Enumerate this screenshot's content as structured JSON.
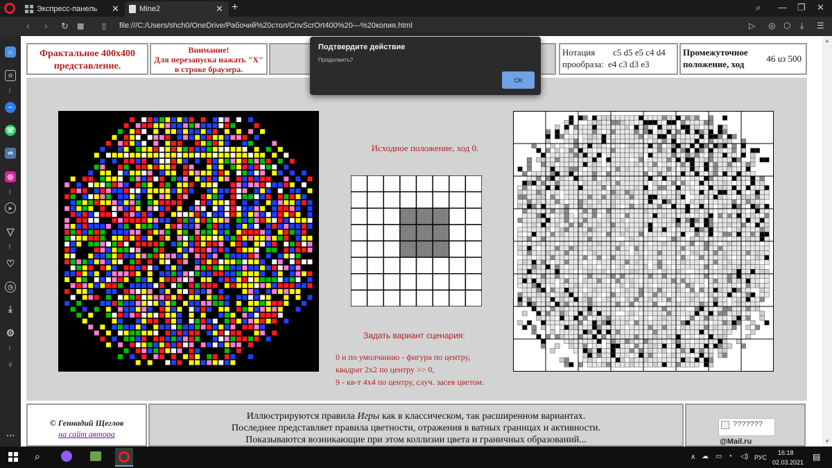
{
  "browser": {
    "tabs": [
      {
        "label": "Экспресс-панель"
      },
      {
        "label": "Mine2"
      }
    ],
    "url": "file:///C:/Users/shch0/OneDrive/Рабочий%20стол/CnvScrOrt400%20—%20копия.html"
  },
  "header": {
    "title_line1": "Фрактальное 400х400",
    "title_line2": "представление.",
    "warn_line1": "Внимание!",
    "warn_line2": "Для перезапуска нажать \"Х\"",
    "warn_line3": "в строке браузера.",
    "notation_label1": "Нотация",
    "notation_label2": "прообраза:",
    "notation_row1": "c5 d5 e5 c4 d4",
    "notation_row2": "e4 c3 d3 e3",
    "status_line1": "Промежуточное",
    "status_line2": "положение, ход",
    "status_count": "46",
    "status_of": "из",
    "status_total": "500"
  },
  "dialog": {
    "title": "Подтвердите действие",
    "message": "Продолжить?",
    "ok_label": "ОК"
  },
  "middle": {
    "position_title": "Исходное положение, ход  0.",
    "grid_size": 8,
    "grid_filled": [
      [
        2,
        3
      ],
      [
        2,
        4
      ],
      [
        2,
        5
      ],
      [
        3,
        3
      ],
      [
        3,
        4
      ],
      [
        3,
        5
      ],
      [
        4,
        3
      ],
      [
        4,
        4
      ],
      [
        4,
        5
      ]
    ],
    "scenario_label": "Задать вариант сценария:",
    "scenario_lines": [
      "0 и по умолчанию - фигура по центру,",
      "квадрат 2х2  по центру  >> 0,",
      "9 - кв-т 4х4 по центру, случ. засев цветом."
    ]
  },
  "footer": {
    "author": "© Геннадий Щеглов",
    "author_link": "на сайт автора",
    "desc_line1_a": "Иллюстрируются правила ",
    "desc_line1_em": "Игры",
    "desc_line1_b": " как в классическом, так расширенном вариантах.",
    "desc_line2": "Последнее представляет правила цветности, отражения в ватных границах и активности.",
    "desc_line3": "Показываются возникающие при этом коллизии цвета и граничных образований...",
    "logo_alt": "???????",
    "logo_text": "@Mail.ru"
  },
  "taskbar": {
    "lang": "РУС",
    "time": "16:18",
    "date": "02.03.2021"
  },
  "colors": {
    "accent_red": "#b22222",
    "panel_gray": "#d3d3d3",
    "dialog_ok": "#6ea3e6"
  }
}
